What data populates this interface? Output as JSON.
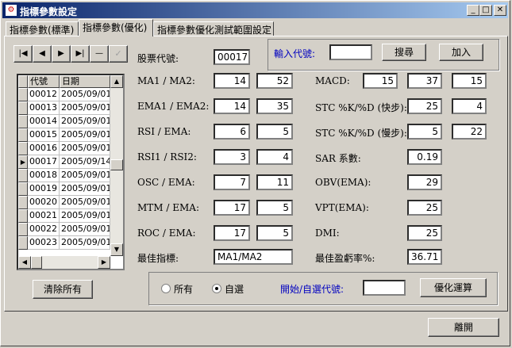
{
  "window": {
    "title": "指標參數設定"
  },
  "tabs": [
    {
      "label": "指標參數(標準)"
    },
    {
      "label": "指標參數(優化)"
    },
    {
      "label": "指標參數優化測試範圍設定"
    }
  ],
  "nav": {
    "first": "|◀",
    "prev": "◀",
    "next": "▶",
    "last": "▶|",
    "delete": "—",
    "post": "✓"
  },
  "grid": {
    "headers": [
      "代號",
      "日期"
    ],
    "current_row": 5,
    "rows": [
      {
        "code": "00012",
        "date": "2005/09/01"
      },
      {
        "code": "00013",
        "date": "2005/09/01"
      },
      {
        "code": "00014",
        "date": "2005/09/01"
      },
      {
        "code": "00015",
        "date": "2005/09/01"
      },
      {
        "code": "00016",
        "date": "2005/09/01"
      },
      {
        "code": "00017",
        "date": "2005/09/14"
      },
      {
        "code": "00018",
        "date": "2005/09/01"
      },
      {
        "code": "00019",
        "date": "2005/09/01"
      },
      {
        "code": "00020",
        "date": "2005/09/01"
      },
      {
        "code": "00021",
        "date": "2005/09/01"
      },
      {
        "code": "00022",
        "date": "2005/09/01"
      },
      {
        "code": "00023",
        "date": "2005/09/01"
      }
    ]
  },
  "stock": {
    "label": "股票代號:",
    "value": "00017"
  },
  "search": {
    "label": "輸入代號:",
    "value": "",
    "search_btn": "搜尋",
    "add_btn": "加入"
  },
  "params_left": [
    {
      "label": "MA1 / MA2:",
      "v1": "14",
      "v2": "52"
    },
    {
      "label": "EMA1 / EMA2:",
      "v1": "14",
      "v2": "35"
    },
    {
      "label": "RSI / EMA:",
      "v1": "6",
      "v2": "5"
    },
    {
      "label": "RSI1 / RSI2:",
      "v1": "3",
      "v2": "4"
    },
    {
      "label": "OSC / EMA:",
      "v1": "7",
      "v2": "11"
    },
    {
      "label": "MTM / EMA:",
      "v1": "17",
      "v2": "5"
    },
    {
      "label": "ROC / EMA:",
      "v1": "17",
      "v2": "5"
    }
  ],
  "best_indicator": {
    "label": "最佳指標:",
    "value": "MA1/MA2"
  },
  "params_right": {
    "macd": {
      "label": "MACD:",
      "v1": "15",
      "v2": "37",
      "v3": "15"
    },
    "stc_fast": {
      "label": "STC %K/%D (快步):",
      "v1": "25",
      "v2": "4"
    },
    "stc_slow": {
      "label": "STC %K/%D (慢步):",
      "v1": "5",
      "v2": "22"
    },
    "sar": {
      "label": "SAR 系數:",
      "v1": "0.19"
    },
    "obv": {
      "label": "OBV(EMA):",
      "v1": "29"
    },
    "vpt": {
      "label": "VPT(EMA):",
      "v1": "25"
    },
    "dmi": {
      "label": "DMI:",
      "v1": "25"
    },
    "best_profit": {
      "label": "最佳盈虧率%:",
      "v1": "36.71"
    }
  },
  "clear_all": "清除所有",
  "bottom": {
    "radio_all": "所有",
    "radio_custom": "自選",
    "selected": "custom",
    "start_label": "開始/自選代號:",
    "start_value": "",
    "optimize_btn": "優化運算"
  },
  "close_btn": "離開",
  "colors": {
    "titlebar_start": "#0a246a",
    "titlebar_end": "#a6caf0",
    "face": "#d4d0c8",
    "link_blue": "#0000c0"
  }
}
